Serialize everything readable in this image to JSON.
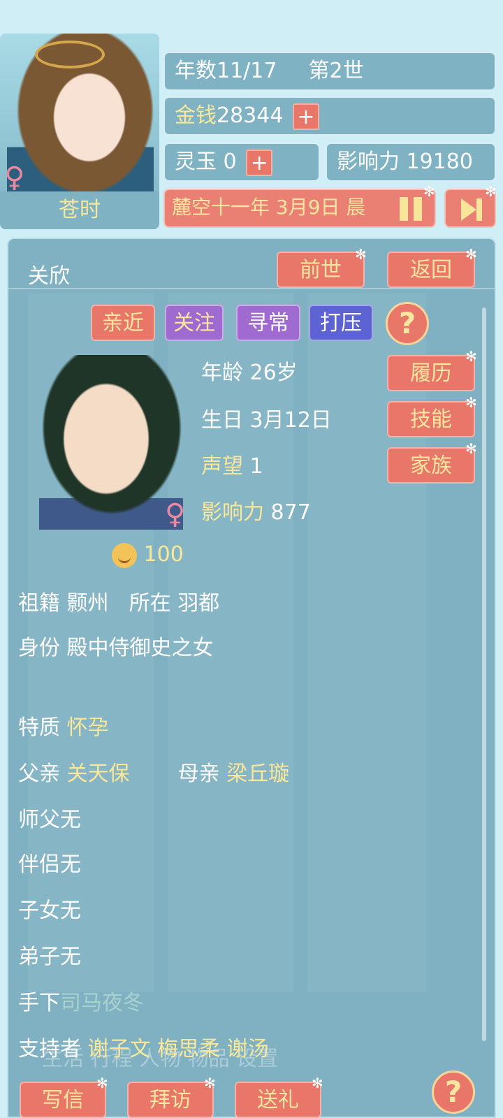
{
  "player": {
    "name": "苍时",
    "gender_icon": "♀",
    "year_label": "年数11/17",
    "generation": "第2世",
    "money_label": "金钱",
    "money_value": "28344",
    "jade_label": "灵玉",
    "jade_value": "0",
    "influence_label": "影响力",
    "influence_value": "19180",
    "date": "麓空十一年 3月9日 晨",
    "plus": "+"
  },
  "character": {
    "name": "关欣",
    "gender_icon": "♀",
    "age_label": "年龄",
    "age_value": "26岁",
    "birthday_label": "生日",
    "birthday_value": "3月12日",
    "reputation_label": "声望",
    "reputation_value": "1",
    "influence_label": "影响力",
    "influence_value": "877",
    "mood_value": "100",
    "origin_label": "祖籍",
    "origin_value": "颢州",
    "location_label": "所在",
    "location_value": "羽都",
    "identity_label": "身份",
    "identity_value": "殿中侍御史之女",
    "trait_label": "特质",
    "trait_value": "怀孕",
    "father_label": "父亲",
    "father_value": "关天保",
    "mother_label": "母亲",
    "mother_value": "梁丘璇",
    "master_label": "师父",
    "master_value": "无",
    "partner_label": "伴侣",
    "partner_value": "无",
    "children_label": "子女",
    "children_value": "无",
    "disciple_label": "弟子",
    "disciple_value": "无",
    "subordinate_label": "手下",
    "subordinate_value": "司马夜冬",
    "supporter_label": "支持者",
    "supporters": "谢子文 梅思柔 谢汤"
  },
  "buttons": {
    "past_life": "前世",
    "back": "返回",
    "close": "亲近",
    "follow": "关注",
    "normal": "寻常",
    "suppress": "打压",
    "help": "?",
    "resume": "履历",
    "skills": "技能",
    "family": "家族",
    "write_letter": "写信",
    "visit": "拜访",
    "gift": "送礼"
  },
  "background_tabs": "生活 行程 人物 物品 设置",
  "colors": {
    "panel": "#7fb1c2",
    "button_red": "#e8776a",
    "button_purple": "#a06bd0",
    "button_blue": "#5d63d2",
    "gold_text": "#f9e79a"
  },
  "icons": [
    "female-icon",
    "pause-icon",
    "skip-icon",
    "help-icon",
    "smile-icon",
    "sparkle-icon"
  ]
}
